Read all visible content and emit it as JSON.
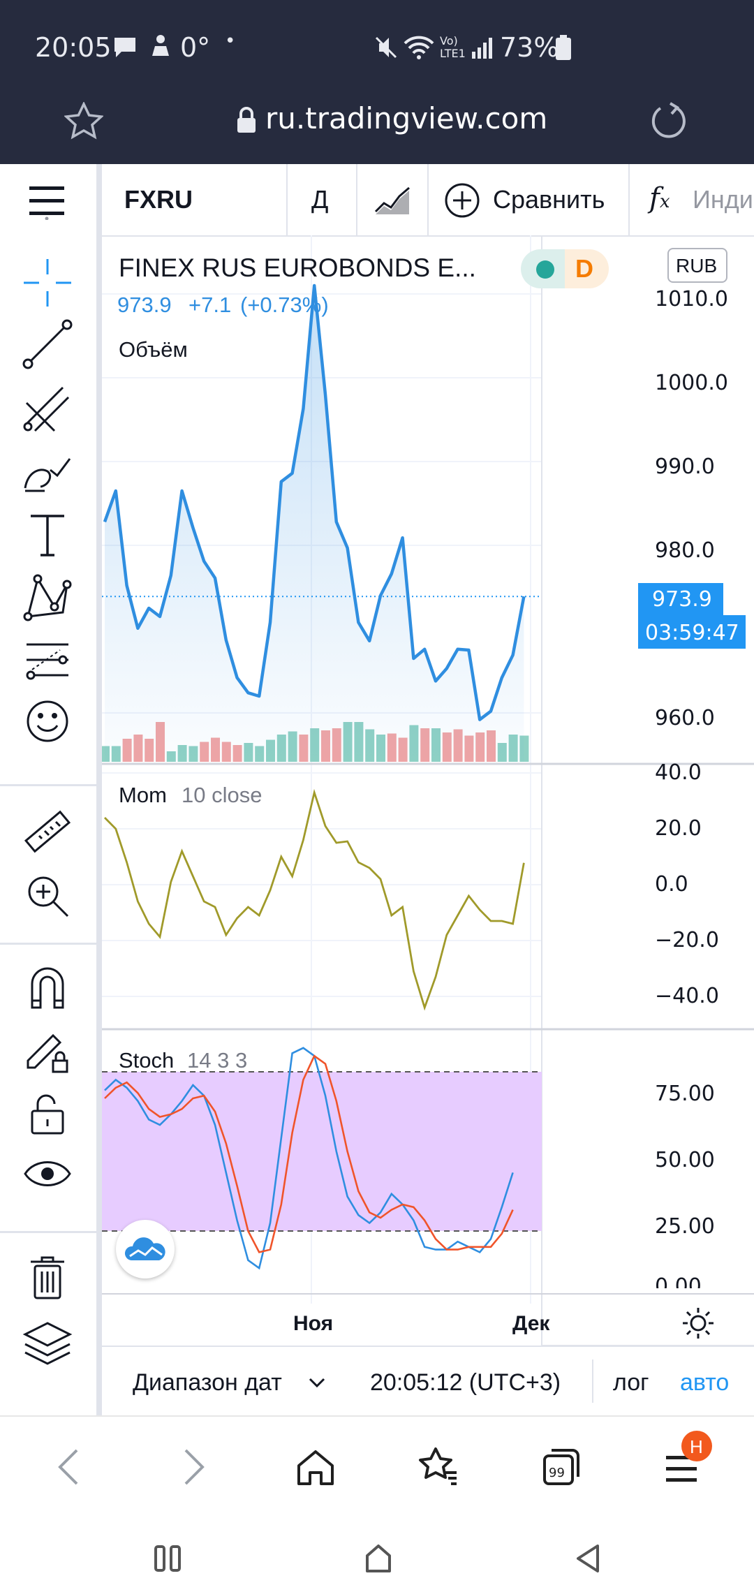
{
  "status": {
    "time": "20:05",
    "temp": "0°",
    "battery": "73%",
    "lte": "LTE1"
  },
  "browser": {
    "url": "ru.tradingview.com"
  },
  "toolbar": {
    "symbol": "FXRU",
    "interval": "Д",
    "compare": "Сравнить",
    "indicators": "Инди"
  },
  "legend": {
    "title": "FINEX RUS EUROBONDS E...",
    "badge": "D",
    "price": "973.9",
    "change": "+7.1",
    "change_pct": "(+0.73%)",
    "volume": "Объём",
    "currency": "RUB"
  },
  "price_axis": {
    "ticks": [
      "1010.0",
      "1000.0",
      "990.0",
      "980.0",
      "960.0"
    ],
    "last": "973.9",
    "countdown": "03:59:47"
  },
  "mom": {
    "name": "Mom",
    "params": "10 close",
    "ticks": [
      "40.0",
      "20.0",
      "0.0",
      "−20.0",
      "−40.0"
    ]
  },
  "stoch": {
    "name": "Stoch",
    "params": "14 3 3",
    "ticks": [
      "75.00",
      "50.00",
      "25.00",
      "0.00"
    ]
  },
  "time_axis": {
    "ticks": [
      "Ноя",
      "Дек"
    ]
  },
  "range": {
    "label": "Диапазон дат",
    "clock": "20:05:12 (UTC+3)",
    "log": "лог",
    "auto": "авто"
  },
  "nav": {
    "badge": "Н"
  },
  "colors": {
    "price": "#2f8ee0",
    "accent": "#2196f3",
    "mom": "#a09a2a",
    "stoch_k": "#2f8ee0",
    "stoch_d": "#f0542a",
    "vol_up": "#8fd1c4",
    "vol_down": "#f1a5a5",
    "band": "#e7ccff"
  },
  "chart_data": [
    {
      "type": "line",
      "title": "FINEX RUS EUROBONDS E...",
      "ylabel": "RUB",
      "ylim": [
        950,
        1013
      ],
      "values": [
        982.8,
        986.5,
        975.2,
        970.1,
        972.5,
        971.5,
        976.4,
        986.5,
        982.1,
        978.1,
        976.1,
        968.7,
        964.2,
        962.4,
        962.0,
        970.8,
        987.6,
        988.6,
        996.3,
        1011.0,
        998.0,
        982.8,
        979.7,
        970.8,
        968.6,
        974.0,
        976.6,
        980.9,
        966.5,
        967.6,
        963.8,
        965.3,
        967.6,
        967.5,
        959.2,
        960.2,
        964.2,
        966.9,
        973.9
      ],
      "volume": [
        15,
        15,
        22,
        26,
        22,
        38,
        10,
        16,
        15,
        19,
        23,
        19,
        16,
        18,
        15,
        21,
        26,
        29,
        26,
        32,
        30,
        32,
        38,
        38,
        31,
        26,
        27,
        23,
        35,
        32,
        32,
        28,
        31,
        25,
        28,
        30,
        18,
        26,
        25
      ],
      "volume_up": [
        true,
        true,
        false,
        false,
        false,
        false,
        true,
        true,
        true,
        false,
        false,
        false,
        false,
        true,
        true,
        true,
        true,
        true,
        false,
        true,
        false,
        false,
        true,
        true,
        true,
        true,
        false,
        false,
        true,
        false,
        true,
        false,
        false,
        false,
        false,
        false,
        true,
        true,
        true
      ],
      "xticks": [
        "Ноя",
        "Дек"
      ]
    },
    {
      "type": "line",
      "title": "Mom",
      "ylim": [
        -50,
        40
      ],
      "values": [
        24.0,
        20.0,
        8.0,
        -6.0,
        -14.0,
        -18.7,
        1.0,
        12.0,
        3.0,
        -6.0,
        -8.0,
        -18.0,
        -12.0,
        -8.0,
        -11.0,
        -2.0,
        10.0,
        3.0,
        16.0,
        33.0,
        21.0,
        15.0,
        15.5,
        8.0,
        6.0,
        2.0,
        -11.0,
        -8.0,
        -31.0,
        -44.0,
        -33.0,
        -18.0,
        -11.0,
        -4.0,
        -9.0,
        -13.0,
        -13.0,
        -14.0,
        7.8
      ]
    },
    {
      "type": "line",
      "title": "Stoch",
      "ylim": [
        0,
        100
      ],
      "bands": [
        20,
        80
      ],
      "series": [
        {
          "values": [
            73,
            77,
            74,
            69,
            62,
            60,
            64,
            69,
            75,
            71,
            60,
            42,
            24,
            9,
            6,
            23,
            55,
            87,
            89,
            86,
            71,
            50,
            33,
            26,
            23,
            27,
            34,
            30,
            24,
            14,
            13,
            13,
            16,
            14,
            12,
            17,
            29,
            42
          ]
        },
        {
          "values": [
            70,
            74,
            76,
            72,
            66,
            63,
            64,
            66,
            70,
            71,
            65,
            53,
            37,
            20,
            12,
            13,
            30,
            57,
            77,
            86,
            83,
            69,
            50,
            35,
            27,
            25,
            28,
            30,
            29,
            24,
            17,
            13,
            13,
            14,
            14,
            14,
            19,
            28
          ]
        }
      ]
    }
  ]
}
